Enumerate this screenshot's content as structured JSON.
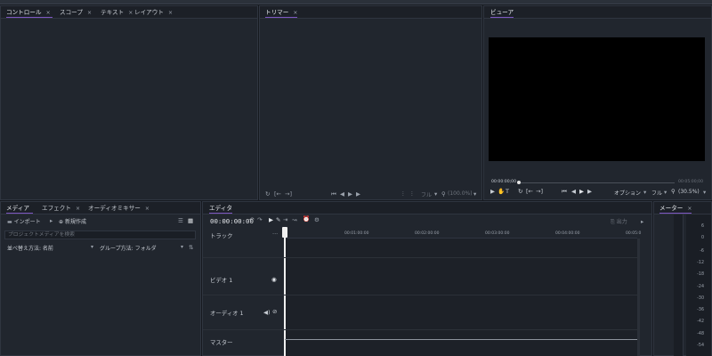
{
  "controls_panel": {
    "tabs": [
      {
        "label": "コントロール"
      },
      {
        "label": "スコープ"
      },
      {
        "label": "テキスト"
      },
      {
        "label": "レイアウト"
      }
    ]
  },
  "trimmer_panel": {
    "tab": "トリマー",
    "zoom_label": "フル",
    "zoom_value": "(100.0%)"
  },
  "viewer_panel": {
    "tab": "ビューア",
    "current_time": "00:00:00;00",
    "end_time": "00:05:00;00",
    "options_label": "オプション",
    "zoom_label": "フル",
    "zoom_value": "(30.5%)"
  },
  "media_panel": {
    "tabs": [
      {
        "label": "メディア"
      },
      {
        "label": "エフェクト"
      },
      {
        "label": "オーディオミキサー"
      }
    ],
    "import_label": "インポート",
    "new_label": "新規作成",
    "search_placeholder": "プロジェクトメディアを検索",
    "sort_label": "並べ替え方法: 名前",
    "group_label": "グループ方法: フォルダ"
  },
  "editor_panel": {
    "tab": "エディタ",
    "timecode": "00:00:00:00",
    "output_label": "出力",
    "tracks_header": "トラック",
    "ruler_ticks": [
      "00:01:00:00",
      "00:02:00:00",
      "00:03:00:00",
      "00:04:00:00",
      "00:05:0"
    ],
    "tracks": [
      {
        "label": "ビデオ 1"
      },
      {
        "label": "オーディオ 1"
      },
      {
        "label": "マスター"
      }
    ]
  },
  "meter_panel": {
    "tab": "メーター",
    "scale": [
      "6",
      "0",
      "-6",
      "-12",
      "-18",
      "-24",
      "-30",
      "-36",
      "-42",
      "-48",
      "-54"
    ]
  }
}
